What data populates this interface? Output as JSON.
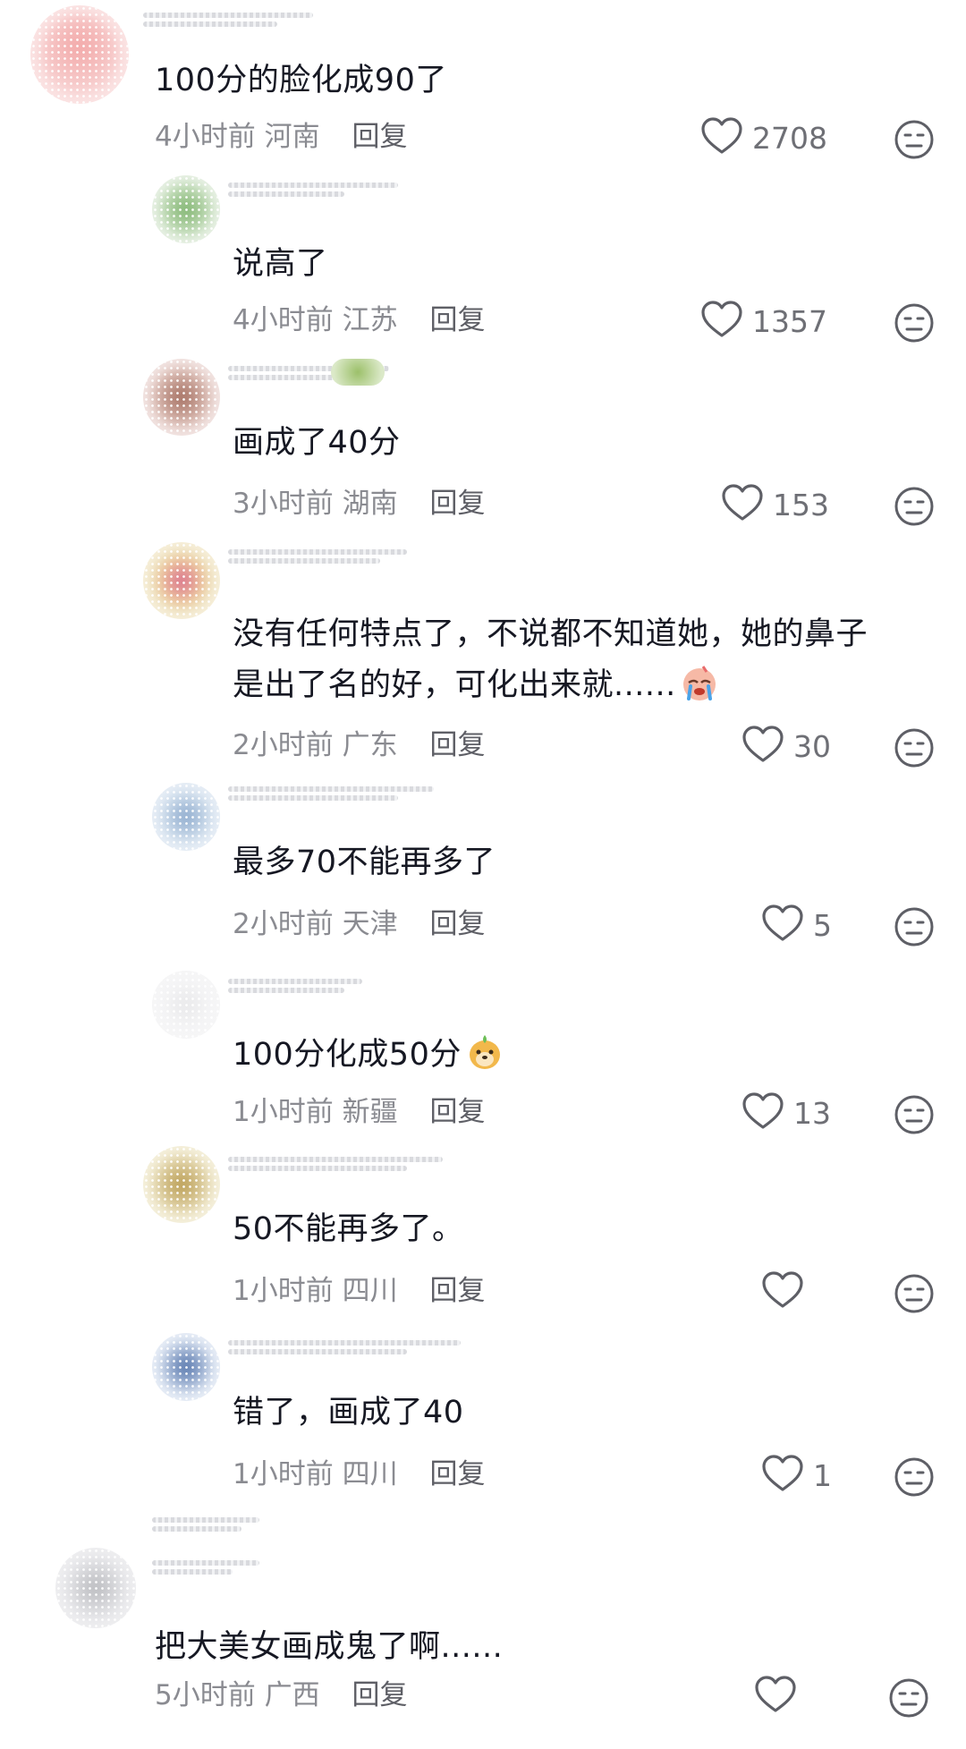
{
  "comments": [
    {
      "text": "100分的脸化成90了",
      "time": "4小时前",
      "region": "河南",
      "reply": "回复",
      "likes": "2708"
    },
    {
      "text": "说高了",
      "time": "4小时前",
      "region": "江苏",
      "reply": "回复",
      "likes": "1357"
    },
    {
      "text": "画成了40分",
      "time": "3小时前",
      "region": "湖南",
      "reply": "回复",
      "likes": "153"
    },
    {
      "text_line1": "没有任何特点了，不说都不知道她，她的鼻子",
      "text_line2": "是出了名的好，可化出来就......",
      "time": "2小时前",
      "region": "广东",
      "reply": "回复",
      "likes": "30"
    },
    {
      "text": "最多70不能再多了",
      "time": "2小时前",
      "region": "天津",
      "reply": "回复",
      "likes": "5"
    },
    {
      "text": "100分化成50分",
      "time": "1小时前",
      "region": "新疆",
      "reply": "回复",
      "likes": "13"
    },
    {
      "text": "50不能再多了。",
      "time": "1小时前",
      "region": "四川",
      "reply": "回复",
      "likes": ""
    },
    {
      "text": "错了，画成了40",
      "time": "1小时前",
      "region": "四川",
      "reply": "回复",
      "likes": "1"
    },
    {
      "text": "把大美女画成鬼了啊......",
      "time": "5小时前",
      "region": "广西",
      "reply": "回复",
      "likes": ""
    }
  ],
  "icons": {
    "like": "heart-outline-icon",
    "dislike": "neutral-face-icon",
    "emoji_crying": "crying-face-emoji",
    "emoji_dog": "dog-face-emoji"
  },
  "colors": {
    "text": "#161823",
    "meta": "#8a8b91",
    "icon": "#5e5f66"
  }
}
